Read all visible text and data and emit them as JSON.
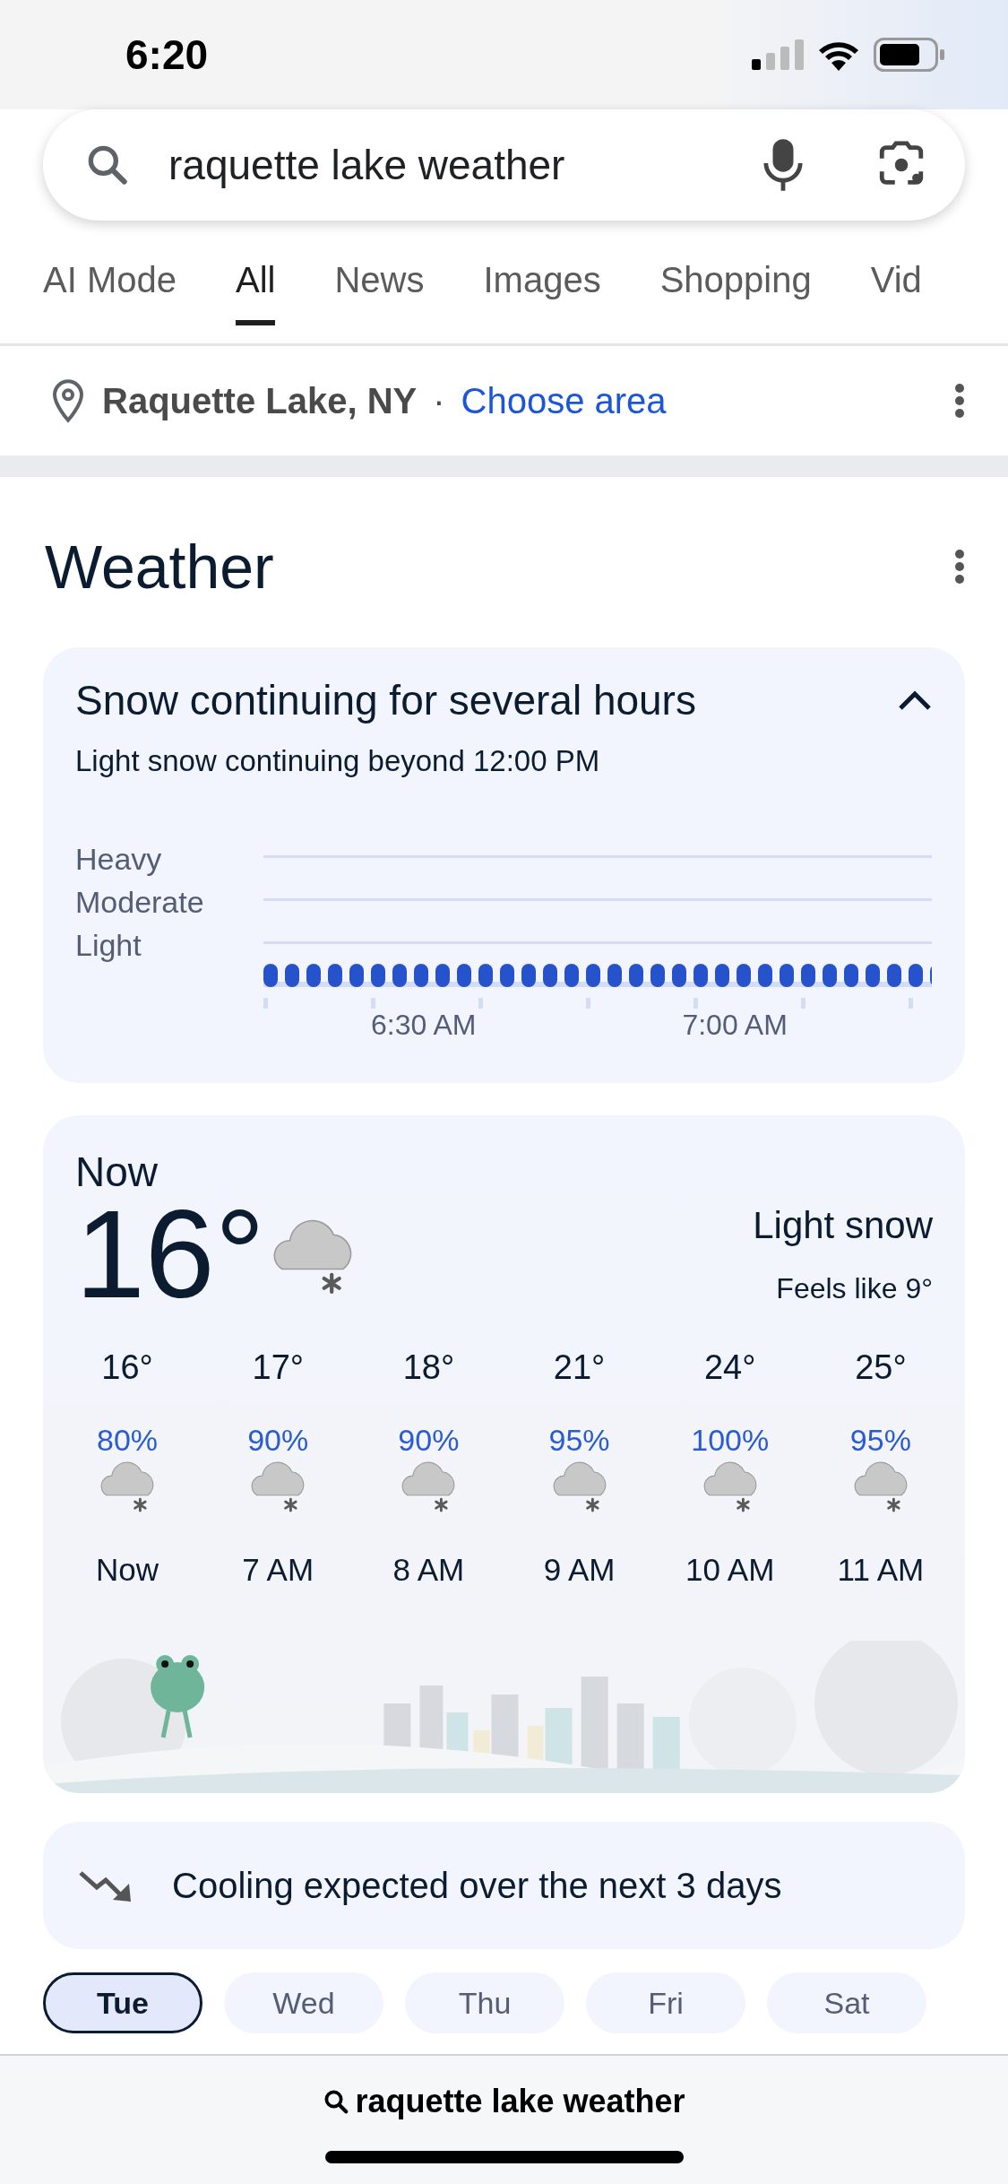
{
  "status_bar": {
    "time": "6:20"
  },
  "search": {
    "value": "raquette lake weather"
  },
  "tabs": [
    {
      "label": "AI Mode",
      "selected": false
    },
    {
      "label": "All",
      "selected": true
    },
    {
      "label": "News",
      "selected": false
    },
    {
      "label": "Images",
      "selected": false
    },
    {
      "label": "Shopping",
      "selected": false
    },
    {
      "label": "Vid",
      "selected": false
    }
  ],
  "location": {
    "place": "Raquette Lake, NY",
    "separator": "·",
    "link": "Choose area"
  },
  "weather": {
    "title": "Weather",
    "alert": {
      "title": "Snow continuing for several hours",
      "expanded": true,
      "subtitle": "Light snow continuing beyond 12:00 PM",
      "levels": [
        "Heavy",
        "Moderate",
        "Light"
      ],
      "times": [
        "6:30 AM",
        "7:00 AM"
      ]
    },
    "now": {
      "label": "Now",
      "temperature": "16°",
      "condition": "Light snow",
      "feels_like": "Feels like 9°"
    },
    "hourly": [
      {
        "temp": "16°",
        "chance": "80%",
        "time": "Now"
      },
      {
        "temp": "17°",
        "chance": "90%",
        "time": "7 AM"
      },
      {
        "temp": "18°",
        "chance": "90%",
        "time": "8 AM"
      },
      {
        "temp": "21°",
        "chance": "95%",
        "time": "9 AM"
      },
      {
        "temp": "24°",
        "chance": "100%",
        "time": "10 AM"
      },
      {
        "temp": "25°",
        "chance": "95%",
        "time": "11 AM"
      }
    ],
    "trend": "Cooling expected over the next 3 days",
    "days": [
      {
        "label": "Tue",
        "selected": true
      },
      {
        "label": "Wed",
        "selected": false
      },
      {
        "label": "Thu",
        "selected": false
      },
      {
        "label": "Fri",
        "selected": false
      },
      {
        "label": "Sat",
        "selected": false
      }
    ]
  },
  "bottom_bar": {
    "query": "raquette lake weather"
  }
}
